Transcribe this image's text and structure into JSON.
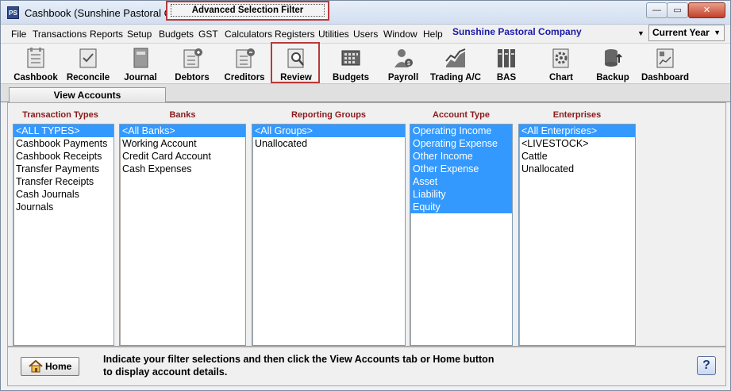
{
  "window": {
    "title": "Cashbook (Sunshine Pastoral Company)",
    "app_icon": "PS",
    "controls": {
      "minimize": "—",
      "maximize": "▭",
      "close": "✕"
    }
  },
  "menu": {
    "items": [
      "File",
      "Transactions",
      "Reports",
      "Setup",
      "Budgets",
      "GST",
      "Calculators",
      "Registers",
      "Utilities",
      "Users",
      "Window",
      "Help"
    ],
    "company": "Sunshine Pastoral Company",
    "company_arrow": "▼",
    "year": "Current Year",
    "year_arrow": "▼"
  },
  "toolbar": {
    "items": [
      "Cashbook",
      "Reconcile",
      "Journal",
      "Debtors",
      "Creditors",
      "Review",
      "Budgets",
      "Payroll",
      "Trading A/C",
      "BAS",
      "Chart",
      "Backup",
      "Dashboard"
    ],
    "highlight_color": "#b83a3a"
  },
  "tabs": {
    "view_accounts": "View Accounts",
    "advanced_filter": "Advanced Selection Filter"
  },
  "columns": {
    "transaction_types": {
      "header": "Transaction Types",
      "items": [
        "<ALL TYPES>",
        "Cashbook Payments",
        "Cashbook Receipts",
        "Transfer Payments",
        "Transfer Receipts",
        "Cash Journals",
        "Journals"
      ]
    },
    "banks": {
      "header": "Banks",
      "items": [
        "<All Banks>",
        "Working Account",
        "Credit Card Account",
        "Cash Expenses"
      ]
    },
    "reporting_groups": {
      "header": "Reporting Groups",
      "items": [
        "<All Groups>",
        "Unallocated"
      ]
    },
    "account_type": {
      "header": "Account Type",
      "items": [
        "Operating Income",
        "Operating Expense",
        "Other Income",
        "Other Expense",
        "Asset",
        "Liability",
        "Equity"
      ]
    },
    "enterprises": {
      "header": "Enterprises",
      "items": [
        "<All Enterprises>",
        "<LIVESTOCK>",
        "Cattle",
        "Unallocated"
      ]
    }
  },
  "footer": {
    "home_label": "Home",
    "hint_line1": "Indicate your filter selections and then click the View Accounts tab or Home button",
    "hint_line2": "to display account details.",
    "help_label": "?"
  },
  "colors": {
    "selection": "#3399ff",
    "column_header": "#8b1a1a",
    "company_name": "#1a1aa8"
  }
}
